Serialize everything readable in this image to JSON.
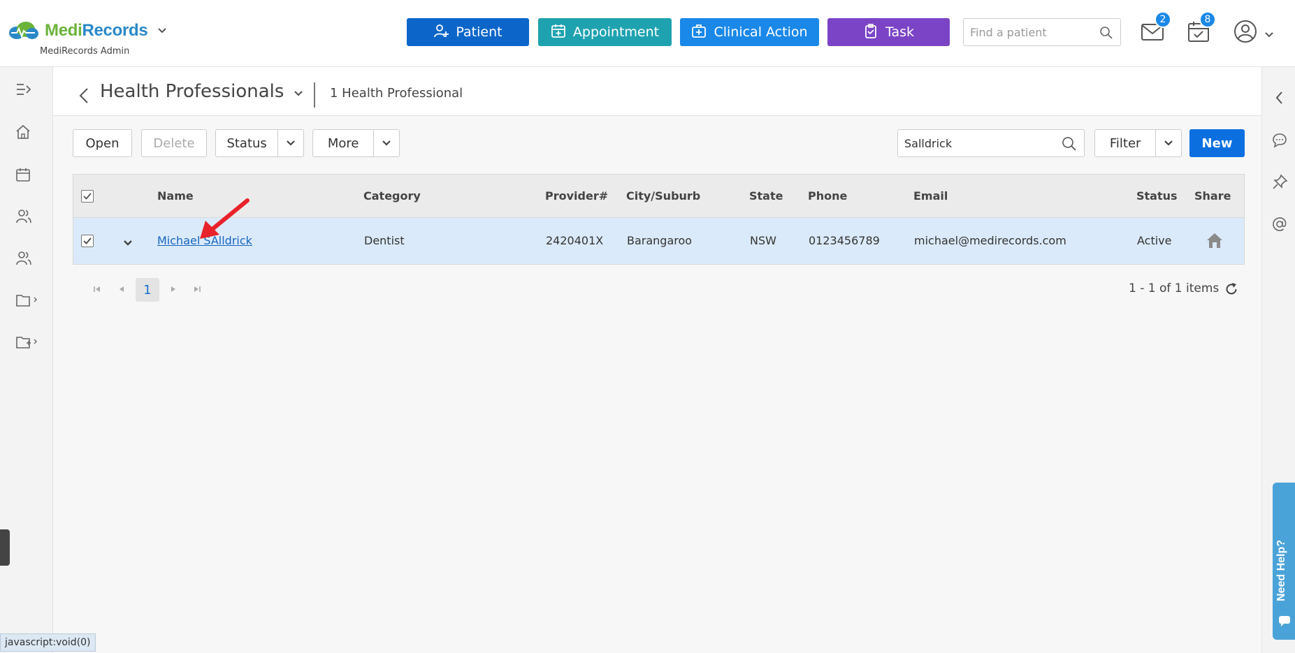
{
  "app": {
    "brand_medi": "Medi",
    "brand_records": "Records",
    "subtitle": "MediRecords Admin"
  },
  "header": {
    "buttons": {
      "patient": "Patient",
      "appointment": "Appointment",
      "clinical_action": "Clinical Action",
      "task": "Task"
    },
    "search_placeholder": "Find a patient",
    "mail_count": "2",
    "calendar_count": "8"
  },
  "page": {
    "title": "Health Professionals",
    "count_label": "1 Health Professional"
  },
  "toolbar": {
    "open": "Open",
    "delete": "Delete",
    "status": "Status",
    "more": "More",
    "search_value": "Salldrick",
    "filter": "Filter",
    "new": "New"
  },
  "grid": {
    "columns": {
      "name": "Name",
      "category": "Category",
      "provider": "Provider#",
      "city": "City/Suburb",
      "state": "State",
      "phone": "Phone",
      "email": "Email",
      "status": "Status",
      "share": "Share"
    },
    "rows": [
      {
        "name": "Michael SAlldrick",
        "category": "Dentist",
        "provider": "2420401X",
        "city": "Barangaroo",
        "state": "NSW",
        "phone": "0123456789",
        "email": "michael@medirecords.com",
        "status": "Active"
      }
    ]
  },
  "pager": {
    "current_page": "1",
    "info": "1 - 1 of 1 items"
  },
  "help_tab": "Need Help?",
  "statusbar_url": "javascript:void(0)",
  "colors": {
    "patient": "#0c66c9",
    "appointment": "#1fa2b0",
    "clinical_action": "#1a88e8",
    "task": "#7b44c6",
    "new": "#0c6fe0",
    "selected_row": "#dbeafa",
    "annotation_arrow": "#e8222a"
  },
  "icons": [
    "logo-cloud-icon",
    "chevron-down-icon",
    "user-plus-icon",
    "calendar-plus-icon",
    "medical-bag-icon",
    "clipboard-icon",
    "search-icon",
    "mail-icon",
    "calendar-check-icon",
    "user-circle-icon",
    "expand-menu-icon",
    "home-icon",
    "calendar-icon",
    "users-icon",
    "folder-icon",
    "folder-plus-icon",
    "chevron-left-icon",
    "chat-icon",
    "pin-icon",
    "at-icon",
    "home-share-icon",
    "refresh-icon",
    "page-first-icon",
    "page-prev-icon",
    "page-next-icon",
    "page-last-icon"
  ]
}
